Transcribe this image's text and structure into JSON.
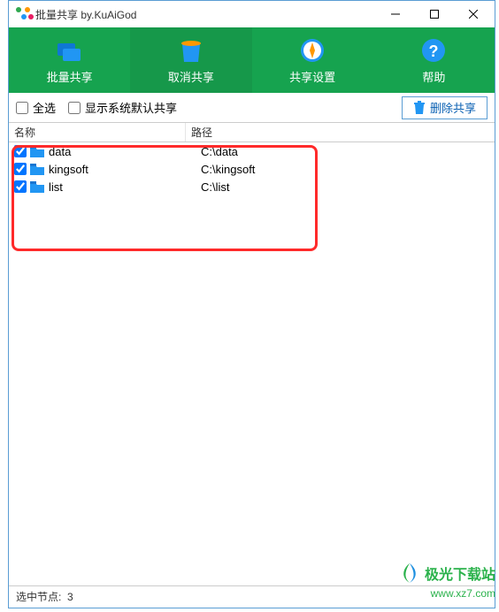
{
  "window": {
    "title": "批量共享 by.KuAiGod"
  },
  "toolbar": {
    "tabs": [
      {
        "label": "批量共享",
        "active": false
      },
      {
        "label": "取消共享",
        "active": true
      },
      {
        "label": "共享设置",
        "active": false
      },
      {
        "label": "帮助",
        "active": false
      }
    ]
  },
  "options": {
    "select_all": "全选",
    "show_system_default": "显示系统默认共享",
    "delete_share": "删除共享"
  },
  "columns": {
    "name": "名称",
    "path": "路径"
  },
  "rows": [
    {
      "checked": true,
      "name": "data",
      "path": "C:\\data"
    },
    {
      "checked": true,
      "name": "kingsoft",
      "path": "C:\\kingsoft"
    },
    {
      "checked": true,
      "name": "list",
      "path": "C:\\list"
    }
  ],
  "status": {
    "label": "选中节点:",
    "count": "3"
  },
  "watermark": {
    "brand": "极光下载站",
    "url": "www.xz7.com"
  }
}
